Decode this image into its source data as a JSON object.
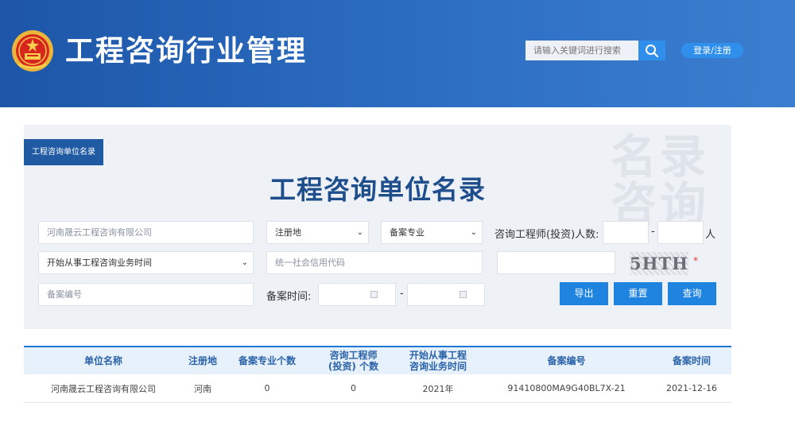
{
  "header": {
    "title": "工程咨询行业管理",
    "search_placeholder": "请输入关键词进行搜索",
    "login_label": "登录/注册"
  },
  "panel": {
    "tag": "工程咨询单位名录",
    "title": "工程咨询单位名录",
    "watermark_line1": "名录",
    "watermark_line2": "咨询"
  },
  "form": {
    "company_name_value": "河南晟云工程咨询有限公司",
    "reg_place_value": "注册地",
    "specialty_value": "备案专业",
    "engineer_count_label": "咨询工程师(投资)人数:",
    "dash": "-",
    "people_unit": "人",
    "start_time_value": "开始从事工程咨询业务时间",
    "credit_code_placeholder": "统一社会信用代码",
    "record_no_placeholder": "备案编号",
    "record_time_label": "备案时间:",
    "captcha_text": "5HTH",
    "required_mark": "*",
    "export_label": "导出",
    "reset_label": "重置",
    "query_label": "查询"
  },
  "table": {
    "headers": [
      "单位名称",
      "注册地",
      "备案专业个数",
      "咨询工程师\n(投资) 个数",
      "开始从事工程\n咨询业务时间",
      "备案编号",
      "备案时间"
    ],
    "rows": [
      {
        "name": "河南晟云工程咨询有限公司",
        "place": "河南",
        "specialty_count": "0",
        "engineer_count": "0",
        "start_year": "2021年",
        "record_no": "91410800MA9G40BL7X-21",
        "record_date": "2021-12-16"
      }
    ]
  },
  "colors": {
    "header_blue": "#1d56a8",
    "accent_blue": "#2f8fea",
    "title_navy": "#1f4e8c",
    "button_blue": "#1e84e0"
  },
  "icons": {
    "emblem": "national-emblem-icon",
    "search": "search-icon",
    "calendar": "calendar-icon",
    "select": "chevron-down-icon"
  }
}
